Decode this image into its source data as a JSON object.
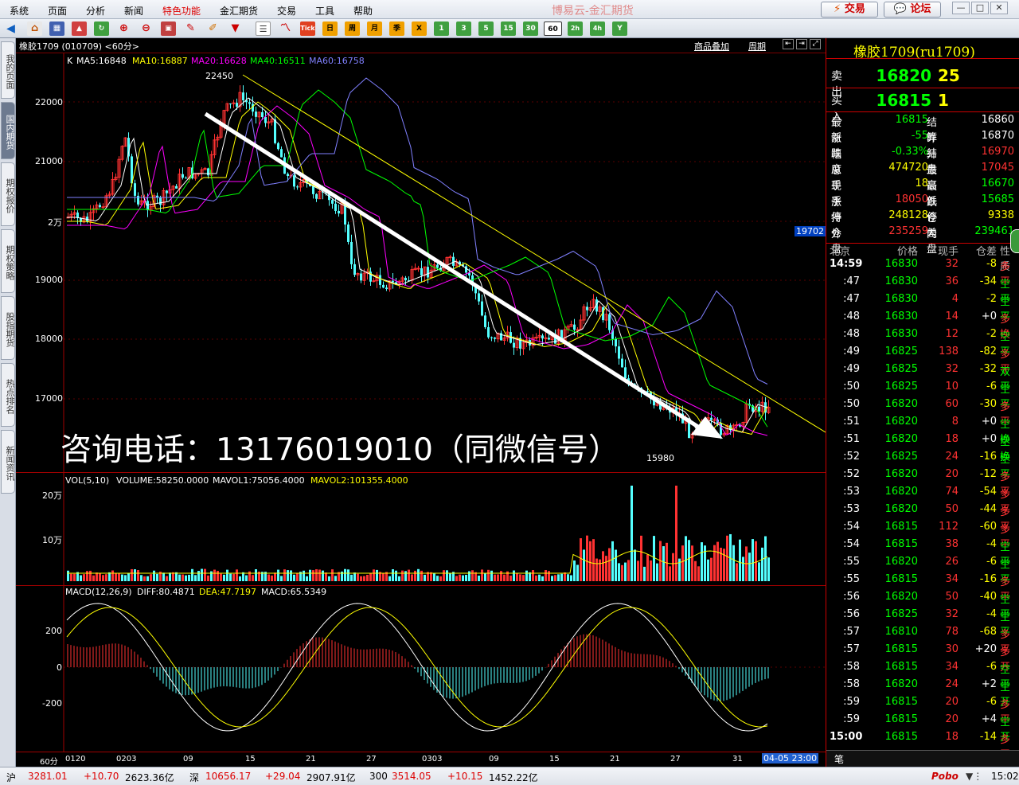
{
  "menu": [
    "系统",
    "页面",
    "分析",
    "新闻",
    "特色功能",
    "金汇期货",
    "交易",
    "工具",
    "帮助"
  ],
  "app_title": "博易云-金汇期货",
  "trade_button": "交易",
  "forum_button": "论坛",
  "toolbar": {
    "tick": "Tick",
    "day": "日",
    "week": "周",
    "month": "月",
    "season": "季",
    "x": "X",
    "m1": "1",
    "m3": "3",
    "m5": "5",
    "m15": "15",
    "m30": "30",
    "m60": "60",
    "h2": "2h",
    "h4": "4h",
    "y": "Y"
  },
  "left_tabs": [
    "我的页面",
    "国内期货",
    "期权报价",
    "期权策略",
    "股指期货",
    "热点排名",
    "新闻资讯"
  ],
  "chart": {
    "header": "橡胶1709 (010709) <60分>",
    "overlay_label": "商品叠加",
    "period_label": "周期",
    "k_label": "K",
    "ma5": "MA5:16848",
    "ma10": "MA10:16887",
    "ma20": "MA20:16628",
    "ma40": "MA40:16511",
    "ma60": "MA60:16758",
    "high_mark": "22450",
    "low_mark": "15980",
    "right_price_tag": "19702",
    "vol_header": "VOL(5,10)",
    "volume": "VOLUME:58250.0000",
    "mavol1": "MAVOL1:75056.4000",
    "mavol2": "MAVOL2:101355.4000",
    "macd_header": "MACD(12,26,9)",
    "diff": "DIFF:80.4871",
    "dea": "DEA:47.7197",
    "macd": "MACD:65.5349",
    "watermark": "咨询电话：13176019010（同微信号）",
    "period_corner": "60分",
    "cursor_time": "04-05 23:00",
    "colors": {
      "ma5": "#ffffff",
      "ma10": "#ffff00",
      "ma20": "#ff00ff",
      "ma40": "#00ff00",
      "ma60": "#8080ff",
      "up": "#ff3232",
      "down": "#54ffff"
    }
  },
  "price_axis": [
    "22000",
    "21000",
    "2万",
    "19000",
    "18000",
    "17000"
  ],
  "vol_axis": [
    "20万",
    "10万"
  ],
  "macd_axis": [
    "200",
    "0",
    "-200"
  ],
  "time_axis": [
    "0120",
    "0203",
    "09",
    "15",
    "21",
    "27",
    "0303",
    "09",
    "15",
    "21",
    "27",
    "31"
  ],
  "quote": {
    "title": "橡胶1709(ru1709)",
    "sell_label": "卖出",
    "sell_price": "16820",
    "sell_vol": "25",
    "buy_label": "买入",
    "buy_price": "16815",
    "buy_vol": "1",
    "fields": [
      {
        "k1": "最新",
        "v1": "16815",
        "c1": "#00ff00",
        "k2": "结算",
        "v2": "16860",
        "c2": "#ffffff"
      },
      {
        "k1": "涨跌",
        "v1": "-55",
        "c1": "#00ff00",
        "k2": "昨结",
        "v2": "16870",
        "c2": "#ffffff"
      },
      {
        "k1": "幅度",
        "v1": "-0.33%",
        "c1": "#00ff00",
        "k2": "开盘",
        "v2": "16970",
        "c2": "#ff3232"
      },
      {
        "k1": "总手",
        "v1": "474720",
        "c1": "#ffff00",
        "k2": "最高",
        "v2": "17045",
        "c2": "#ff3232"
      },
      {
        "k1": "现手",
        "v1": "18",
        "c1": "#ffff00",
        "k2": "最低",
        "v2": "16670",
        "c2": "#00ff00"
      },
      {
        "k1": "涨停",
        "v1": "18050",
        "c1": "#ff3232",
        "k2": "跌停",
        "v2": "15685",
        "c2": "#00ff00"
      },
      {
        "k1": "持仓",
        "v1": "248128",
        "c1": "#ffff00",
        "k2": "仓差",
        "v2": "9338",
        "c2": "#ffff00"
      },
      {
        "k1": "外盘",
        "v1": "235259",
        "c1": "#ff3232",
        "k2": "内盘",
        "v2": "239461",
        "c2": "#00ff00"
      }
    ],
    "tick_headers": [
      "北京",
      "价格",
      "现手",
      "仓差",
      "性质"
    ],
    "ticks": [
      {
        "t": "14:59",
        "p": "16830",
        "v": "32",
        "d": "-8",
        "n": "多平"
      },
      {
        "t": ":47",
        "p": "16830",
        "v": "36",
        "d": "-34",
        "n": "空平"
      },
      {
        "t": ":47",
        "p": "16830",
        "v": "4",
        "d": "-2",
        "n": "空平"
      },
      {
        "t": ":48",
        "p": "16830",
        "v": "14",
        "d": "+0",
        "n": "多换"
      },
      {
        "t": ":48",
        "p": "16830",
        "v": "12",
        "d": "-2",
        "n": "空平"
      },
      {
        "t": ":49",
        "p": "16825",
        "v": "138",
        "d": "-82",
        "n": "多平"
      },
      {
        "t": ":49",
        "p": "16825",
        "v": "32",
        "d": "-32",
        "n": "双平"
      },
      {
        "t": ":50",
        "p": "16825",
        "v": "10",
        "d": "-6",
        "n": "空平"
      },
      {
        "t": ":50",
        "p": "16820",
        "v": "60",
        "d": "-30",
        "n": "多平"
      },
      {
        "t": ":51",
        "p": "16820",
        "v": "8",
        "d": "+0",
        "n": "空换"
      },
      {
        "t": ":51",
        "p": "16820",
        "v": "18",
        "d": "+0",
        "n": "空换"
      },
      {
        "t": ":52",
        "p": "16825",
        "v": "24",
        "d": "-16",
        "n": "空平"
      },
      {
        "t": ":52",
        "p": "16820",
        "v": "20",
        "d": "-12",
        "n": "多平"
      },
      {
        "t": ":53",
        "p": "16820",
        "v": "74",
        "d": "-54",
        "n": "多平"
      },
      {
        "t": ":53",
        "p": "16820",
        "v": "50",
        "d": "-44",
        "n": "多平"
      },
      {
        "t": ":54",
        "p": "16815",
        "v": "112",
        "d": "-60",
        "n": "多平"
      },
      {
        "t": ":54",
        "p": "16815",
        "v": "38",
        "d": "-4",
        "n": "空平"
      },
      {
        "t": ":55",
        "p": "16820",
        "v": "26",
        "d": "-6",
        "n": "空平"
      },
      {
        "t": ":55",
        "p": "16815",
        "v": "34",
        "d": "-16",
        "n": "多平"
      },
      {
        "t": ":56",
        "p": "16820",
        "v": "50",
        "d": "-40",
        "n": "空平"
      },
      {
        "t": ":56",
        "p": "16825",
        "v": "32",
        "d": "-4",
        "n": "空平"
      },
      {
        "t": ":57",
        "p": "16810",
        "v": "78",
        "d": "-68",
        "n": "多平"
      },
      {
        "t": ":57",
        "p": "16815",
        "v": "30",
        "d": "+20",
        "n": "多开"
      },
      {
        "t": ":58",
        "p": "16815",
        "v": "34",
        "d": "-6",
        "n": "空平"
      },
      {
        "t": ":58",
        "p": "16820",
        "v": "24",
        "d": "+2",
        "n": "空开"
      },
      {
        "t": ":59",
        "p": "16815",
        "v": "20",
        "d": "-6",
        "n": "多平"
      },
      {
        "t": ":59",
        "p": "16815",
        "v": "20",
        "d": "+4",
        "n": "空开"
      },
      {
        "t": "15:00",
        "p": "16815",
        "v": "18",
        "d": "-14",
        "n": "多平"
      }
    ],
    "bottom_tab": "笔"
  },
  "status": {
    "sh_label": "沪",
    "sh_val": "3281.01",
    "sh_chg": "+10.70",
    "sh_amt": "2623.36亿",
    "sz_label": "深",
    "sz_val": "10656.17",
    "sz_chg": "+29.04",
    "sz_amt": "2907.91亿",
    "hs_label": "300",
    "hs_val": "3514.05",
    "hs_chg": "+10.15",
    "hs_amt": "1452.22亿",
    "brand": "Pobo",
    "time": "15:02"
  }
}
